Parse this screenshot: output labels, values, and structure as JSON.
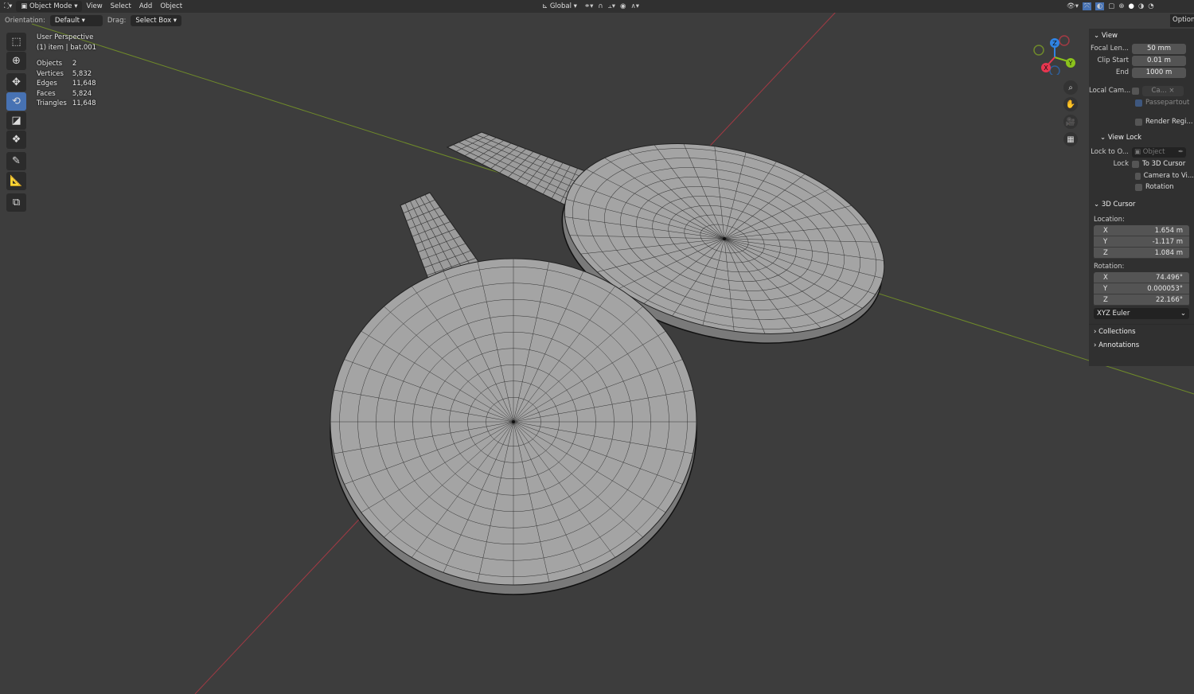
{
  "header": {
    "menu": [
      "View",
      "Select",
      "Add",
      "Object"
    ],
    "mode": "Object Mode",
    "transform_orientation": "Global"
  },
  "toolbar_row": {
    "orientation_label": "Orientation:",
    "orientation_value": "Default",
    "drag_label": "Drag:",
    "drag_value": "Select Box",
    "options_label": "Options"
  },
  "overlay": {
    "view_name": "User Perspective",
    "selection": "(1) item | bat.001",
    "stats": [
      {
        "k": "Objects",
        "v": "2"
      },
      {
        "k": "Vertices",
        "v": "5,832"
      },
      {
        "k": "Edges",
        "v": "11,648"
      },
      {
        "k": "Faces",
        "v": "5,824"
      },
      {
        "k": "Triangles",
        "v": "11,648"
      }
    ]
  },
  "tools": [
    "select-box",
    "cursor",
    "move",
    "rotate",
    "scale",
    "transform",
    "annotate",
    "measure",
    "add-cube"
  ],
  "gizmo": {
    "x": "X",
    "y": "Y",
    "z": "Z",
    "colors": {
      "x": "#e8364f",
      "y": "#8bc21c",
      "z": "#2f83e3"
    }
  },
  "panel": {
    "view": {
      "title": "View",
      "focal_label": "Focal Len...",
      "focal": "50 mm",
      "clip_start_label": "Clip Start",
      "clip_start": "0.01 m",
      "end_label": "End",
      "end": "1000 m",
      "local_cam_label": "Local Cam...",
      "local_cam_value": "Ca...",
      "passepartout": "Passepartout",
      "render_region": "Render Regi..."
    },
    "view_lock": {
      "title": "View Lock",
      "lock_to_label": "Lock to O...",
      "lock_to_placeholder": "Object",
      "lock_label": "Lock",
      "to_cursor": "To 3D Cursor",
      "camera_to_view": "Camera to Vi...",
      "rotation": "Rotation"
    },
    "cursor": {
      "title": "3D Cursor",
      "location_label": "Location:",
      "location": [
        {
          "k": "X",
          "v": "1.654 m"
        },
        {
          "k": "Y",
          "v": "-1.117 m"
        },
        {
          "k": "Z",
          "v": "1.084 m"
        }
      ],
      "rotation_label": "Rotation:",
      "rotation": [
        {
          "k": "X",
          "v": "74.496°"
        },
        {
          "k": "Y",
          "v": "0.000053°"
        },
        {
          "k": "Z",
          "v": "22.166°"
        }
      ],
      "rotation_mode": "XYZ Euler"
    },
    "collections": "Collections",
    "annotations": "Annotations"
  }
}
